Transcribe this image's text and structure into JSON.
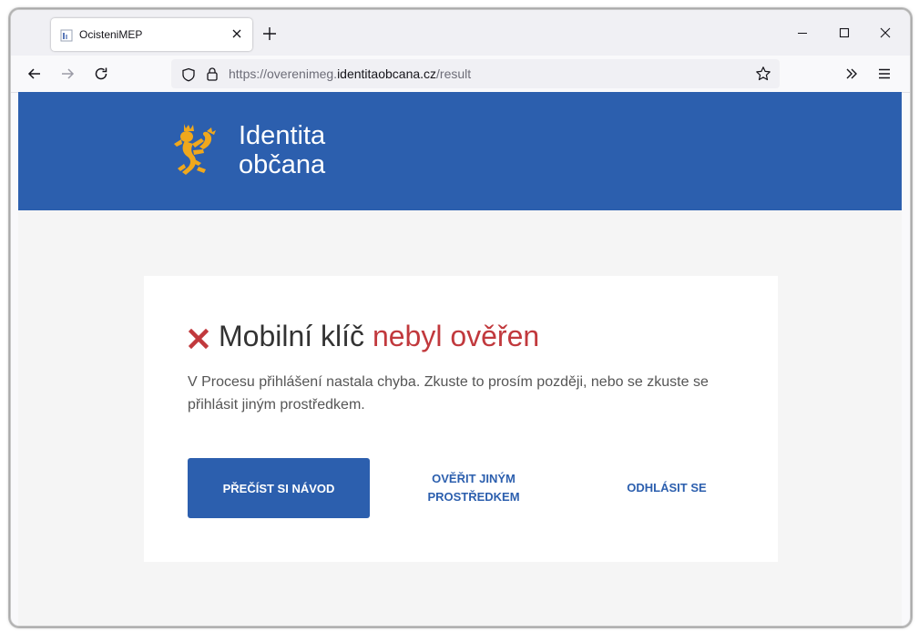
{
  "browser": {
    "tab_title": "OcisteniMEP",
    "url_prefix": "https://overenimeg.",
    "url_host": "identitaobcana.cz",
    "url_path": "/result"
  },
  "header": {
    "brand_line1": "Identita",
    "brand_line2": "občana"
  },
  "card": {
    "title_normal": "Mobilní klíč",
    "title_red": "nebyl ověřen",
    "description": "V Procesu přihlášení nastala chyba. Zkuste to prosím později, nebo se zkuste se přihlásit jiným prostředkem.",
    "primary_button": "PŘEČÍST SI NÁVOD",
    "alt_button_line1": "OVĚŘIT JINÝM",
    "alt_button_line2": "PROSTŘEDKEM",
    "logout_button": "ODHLÁSIT SE"
  },
  "colors": {
    "brand_blue": "#2c5fae",
    "error_red": "#c1393d",
    "lion_gold": "#f0a81c"
  }
}
